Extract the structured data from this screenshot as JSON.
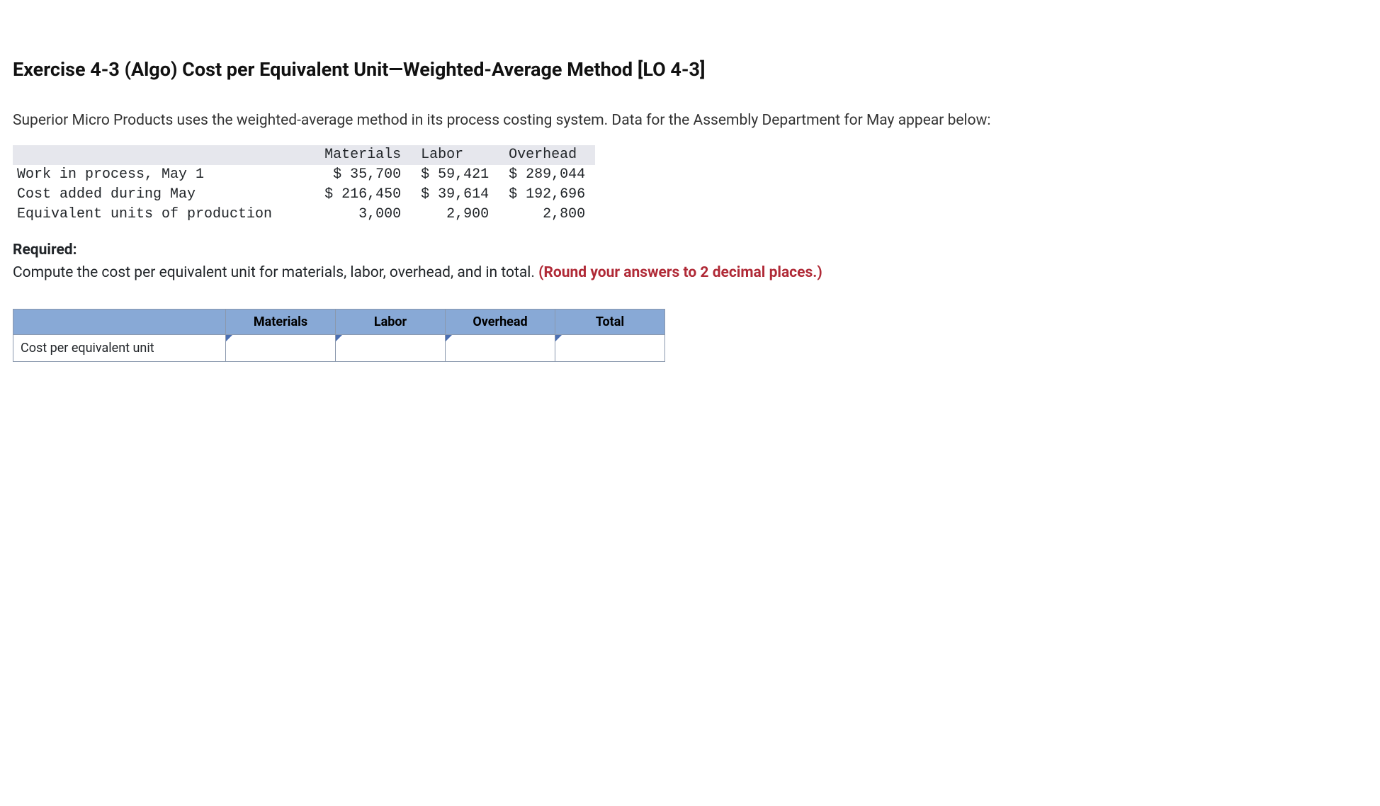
{
  "title": "Exercise 4-3 (Algo) Cost per Equivalent Unit—Weighted-Average Method [LO 4-3]",
  "intro": "Superior Micro Products uses the weighted-average method in its process costing system. Data for the Assembly Department for May appear below:",
  "data_table": {
    "headers": {
      "blank": "",
      "materials": "Materials",
      "labor": "Labor",
      "overhead": "Overhead"
    },
    "rows": [
      {
        "label": "Work in process, May 1",
        "materials": "$ 35,700",
        "labor": "$ 59,421",
        "overhead": "$ 289,044"
      },
      {
        "label": "Cost added during May",
        "materials": "$ 216,450",
        "labor": "$ 39,614",
        "overhead": "$ 192,696"
      },
      {
        "label": "Equivalent units of production",
        "materials": "3,000",
        "labor": "2,900",
        "overhead": "2,800"
      }
    ]
  },
  "required": {
    "label": "Required:",
    "text": "Compute the cost per equivalent unit for materials, labor, overhead, and in total. ",
    "hint": "(Round your answers to 2 decimal places.)"
  },
  "answer_table": {
    "headers": {
      "materials": "Materials",
      "labor": "Labor",
      "overhead": "Overhead",
      "total": "Total"
    },
    "row_label": "Cost per equivalent unit"
  }
}
